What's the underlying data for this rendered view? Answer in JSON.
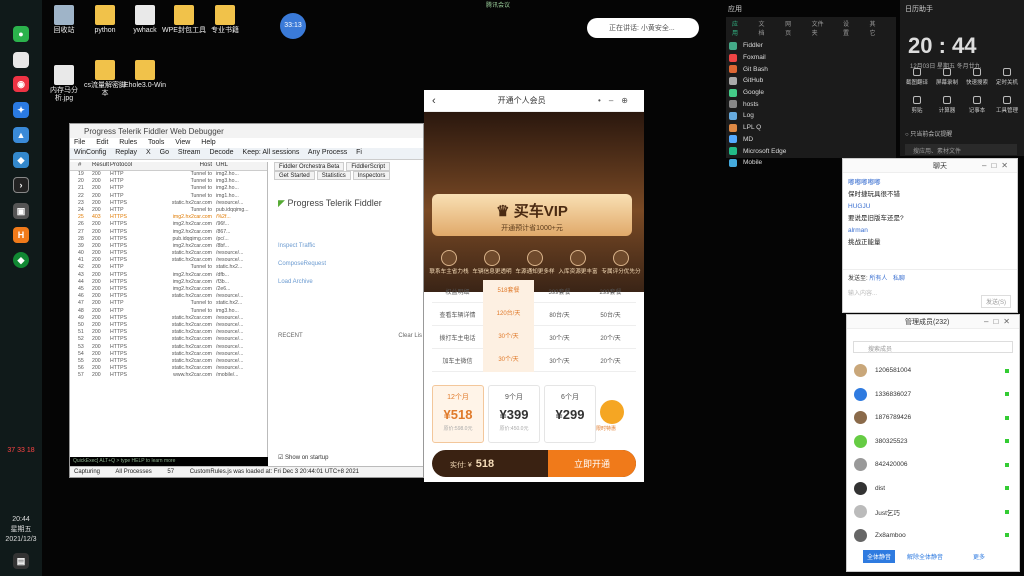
{
  "meeting_bar": "腾讯会议",
  "timer": "33:13",
  "recording_pill": "正在讲话: 小黄安全...",
  "taskbar": {
    "clock_time": "20:44",
    "clock_day": "星期五",
    "clock_date": "2021/12/3",
    "badge_a": "37",
    "badge_b": "33",
    "badge_c": "18"
  },
  "desktop_icons": [
    "回收站",
    "python",
    "ywhack",
    "WPE封包工具",
    "专业书籍",
    "内存马分析.jpg",
    "cs流量解密脚本",
    "Ehole3.0-Win"
  ],
  "fiddler": {
    "title": "Progress Telerik Fiddler Web Debugger",
    "menu": [
      "File",
      "Edit",
      "Rules",
      "Tools",
      "View",
      "Help"
    ],
    "toolbar": [
      "WinConfig",
      "Replay",
      "X",
      "Go",
      "Stream",
      "Decode",
      "Keep: All sessions",
      "Any Process",
      "Fi"
    ],
    "columns": [
      "#",
      "Result",
      "Protocol",
      "Host",
      "URL"
    ],
    "rows": [
      [
        "19",
        "200",
        "HTTP",
        "Tunnel to",
        "img2.ho..."
      ],
      [
        "20",
        "200",
        "HTTP",
        "Tunnel to",
        "img3.ho..."
      ],
      [
        "21",
        "200",
        "HTTP",
        "Tunnel to",
        "img2.ho..."
      ],
      [
        "22",
        "200",
        "HTTP",
        "Tunnel to",
        "img1.ho..."
      ],
      [
        "23",
        "200",
        "HTTPS",
        "static.hx2car.com",
        "/resource/..."
      ],
      [
        "24",
        "200",
        "HTTP",
        "Tunnel to",
        "pub.idqqimg..."
      ],
      [
        "25",
        "403",
        "HTTPS",
        "img2.hx2car.com",
        "/%2f..."
      ],
      [
        "26",
        "200",
        "HTTPS",
        "img2.hx2car.com",
        "/96f..."
      ],
      [
        "27",
        "200",
        "HTTPS",
        "img2.hx2car.com",
        "/867..."
      ],
      [
        "28",
        "200",
        "HTTPS",
        "pub.idqqimg.com",
        "/pc/..."
      ],
      [
        "39",
        "200",
        "HTTPS",
        "img2.hx2car.com",
        "/8bf..."
      ],
      [
        "40",
        "200",
        "HTTPS",
        "static.hx2car.com",
        "/resource/..."
      ],
      [
        "41",
        "200",
        "HTTPS",
        "static.hx2car.com",
        "/resource/..."
      ],
      [
        "42",
        "200",
        "HTTP",
        "Tunnel to",
        "static.hx2..."
      ],
      [
        "43",
        "200",
        "HTTPS",
        "img2.hx2car.com",
        "/dfb..."
      ],
      [
        "44",
        "200",
        "HTTPS",
        "img2.hx2car.com",
        "/f3b..."
      ],
      [
        "45",
        "200",
        "HTTPS",
        "img2.hx2car.com",
        "/2e6..."
      ],
      [
        "46",
        "200",
        "HTTPS",
        "static.hx2car.com",
        "/resource/..."
      ],
      [
        "47",
        "200",
        "HTTP",
        "Tunnel to",
        "static.hx2..."
      ],
      [
        "48",
        "200",
        "HTTP",
        "Tunnel to",
        "img3.ho..."
      ],
      [
        "49",
        "200",
        "HTTPS",
        "static.hx2car.com",
        "/resource/..."
      ],
      [
        "50",
        "200",
        "HTTPS",
        "static.hx2car.com",
        "/resource/..."
      ],
      [
        "51",
        "200",
        "HTTPS",
        "static.hx2car.com",
        "/resource/..."
      ],
      [
        "52",
        "200",
        "HTTPS",
        "static.hx2car.com",
        "/resource/..."
      ],
      [
        "53",
        "200",
        "HTTPS",
        "static.hx2car.com",
        "/resource/..."
      ],
      [
        "54",
        "200",
        "HTTPS",
        "static.hx2car.com",
        "/resource/..."
      ],
      [
        "55",
        "200",
        "HTTPS",
        "static.hx2car.com",
        "/resource/..."
      ],
      [
        "56",
        "200",
        "HTTPS",
        "static.hx2car.com",
        "/resource/..."
      ],
      [
        "57",
        "200",
        "HTTPS",
        "www.hx2car.com",
        "/mobile/..."
      ]
    ],
    "tabs_top": [
      "Fiddler Orchestra Beta",
      "FiddlerScript"
    ],
    "tabs_bottom": [
      "Get Started",
      "Statistics",
      "Inspectors"
    ],
    "brand": "Progress Telerik Fiddler",
    "links": [
      "Inspect Traffic",
      "ComposeRequest",
      "Load Archive"
    ],
    "recent": "RECENT",
    "clear": "Clear Lis",
    "show_startup": "Show on startup",
    "quickexec": "QuickExec] ALT+Q > type HELP to learn more",
    "status": [
      "Capturing",
      "All Processes",
      "57",
      "CustomRules.js was loaded at: Fri Dec 3 20:44:01 UTC+8 2021"
    ]
  },
  "vip": {
    "header": "开通个人会员",
    "title": "买车VIP",
    "subtitle": "开通预计省1000+元",
    "perks": [
      "联系车主省力栈",
      "车辆信息更透明",
      "车源通知更多样",
      "入库资源更丰富",
      "专属评分优先分"
    ],
    "table": [
      [
        "权益明细",
        "518套餐",
        "399套餐",
        "299套餐"
      ],
      [
        "查看车辆详情",
        "120台/天",
        "80台/天",
        "50台/天"
      ],
      [
        "拨打车主电话",
        "30个/天",
        "30个/天",
        "20个/天"
      ],
      [
        "加车主微信",
        "30个/天",
        "30个/天",
        "20个/天"
      ]
    ],
    "plans": [
      {
        "month": "12个月",
        "price": "518",
        "orig": "原价:598.0元"
      },
      {
        "month": "9个月",
        "price": "399",
        "orig": "原价:450.0元"
      },
      {
        "month": "6个月",
        "price": "299",
        "orig": ""
      }
    ],
    "mascot_label": "限时特惠",
    "pay_label": "实付: ¥",
    "pay_amount": "518",
    "pay_button": "立即开通"
  },
  "startmenu": {
    "tabs": [
      "应用",
      "文档",
      "网页",
      "文件夹",
      "设置",
      "其它"
    ],
    "header": "应用",
    "items": [
      "Fiddler",
      "Foxmail",
      "Git Bash",
      "GitHub",
      "Google",
      "hosts",
      "Log",
      "LPL Q",
      "MD",
      "Microsoft Edge",
      "Mobile"
    ],
    "item_colors": [
      "#4a8",
      "#e44",
      "#d63",
      "#aaa",
      "#4c8",
      "#888",
      "#6ad",
      "#d84",
      "#5af",
      "#2b8",
      "#4ad"
    ]
  },
  "clockpanel": {
    "title": "日历助手",
    "time": "20 : 44",
    "date": "12月03日  星期五  冬月廿九",
    "actions": [
      "截图翻译",
      "屏幕录制",
      "快速搜索",
      "定时关机",
      "剪贴",
      "计算器",
      "记事本",
      "工具管理"
    ],
    "notify_label": "只当前会议提醒",
    "search_placeholder": "搜应用、素材文件"
  },
  "chat": {
    "title": "聊天",
    "messages": [
      {
        "user": "嘟嘟嘟嘟嘟",
        "text": "保时捷玩具很不错"
      },
      {
        "user": "HUGJU",
        "text": "要说是旧版车还是?"
      },
      {
        "user": "alrman",
        "text": "挑战正能量"
      }
    ],
    "send_to_label": "发送至:",
    "send_to_value": "所有人",
    "private_label": "私聊",
    "input_placeholder": "输入内容...",
    "send_button": "发送(S)"
  },
  "members": {
    "title": "管理成员(232)",
    "search_placeholder": "搜索成员",
    "list": [
      "1206581004",
      "1336836027",
      "1876789426",
      "380325523",
      "842420006",
      "dist",
      "Just乞巧",
      "Zx8amboo"
    ],
    "avatar_colors": [
      "#c9a77a",
      "#2f7be0",
      "#8a6a4a",
      "#6c4",
      "#999",
      "#333",
      "#bbb",
      "#666"
    ],
    "buttons": [
      "全体静音",
      "解除全体静音",
      "更多"
    ]
  }
}
